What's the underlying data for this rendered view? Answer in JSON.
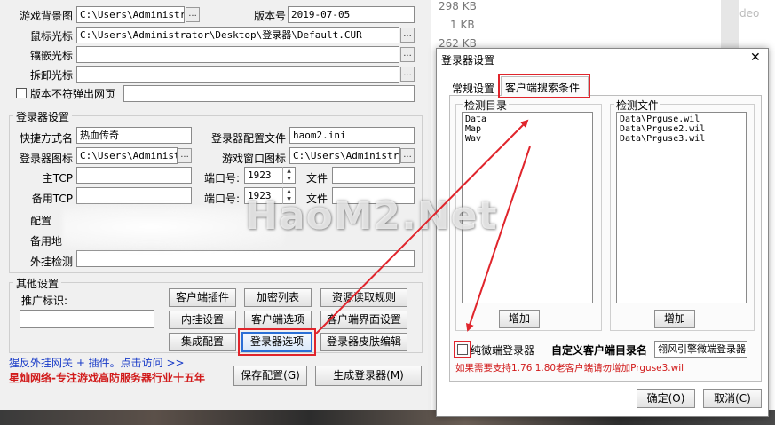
{
  "left": {
    "top_rows": {
      "game_bg_label": "游戏背景图",
      "game_bg_value": "C:\\Users\\Administrat",
      "version_label": "版本号",
      "version_value": "2019-07-05",
      "mouse_cursor_label": "鼠标光标",
      "mouse_cursor_value": "C:\\Users\\Administrator\\Desktop\\登录器\\Default.CUR",
      "inlay_cursor_label": "镶嵌光标",
      "unload_cursor_label": "拆卸光标",
      "version_popup_label": "版本不符弹出网页",
      "browse": "..."
    },
    "launcher_group": {
      "title": "登录器设置",
      "shortcut_label": "快捷方式名",
      "shortcut_value": "热血传奇",
      "config_file_label": "登录器配置文件",
      "config_file_value": "haom2.ini",
      "icon_label": "登录器图标",
      "icon_value": "C:\\Users\\Administra",
      "window_icon_label": "游戏窗口图标",
      "window_icon_value": "C:\\Users\\Administrato",
      "main_tcp_label": "主TCP",
      "port_label": "端口号:",
      "port1_value": "1923",
      "file_label": "文件",
      "backup_tcp_label": "备用TCP",
      "port2_value": "1923",
      "config_addr_label": "配置",
      "backup_addr_label": "备用地",
      "plugin_detect_label": "外挂检测"
    },
    "other_group": {
      "title": "其他设置",
      "promo_label": "推广标识:",
      "buttons": {
        "client_plugin": "客户端插件",
        "encrypt_list": "加密列表",
        "resource_rules": "资源读取规则",
        "inline_settings": "内挂设置",
        "client_options": "客户端选项",
        "client_ui_settings": "客户端界面设置",
        "integrated_config": "集成配置",
        "launcher_options": "登录器选项",
        "launcher_skin": "登录器皮肤编辑"
      }
    },
    "footer": {
      "anti_cheat_link": "猩反外挂网关 + 插件。点击访问 >>",
      "tagline": "星灿网络-专注游戏高防服务器行业十五年",
      "save_config": "保存配置(G)",
      "generate_launcher": "生成登录器(M)"
    }
  },
  "background_list": {
    "sizes": [
      "298 KB",
      "1 KB",
      "262 KB"
    ],
    "right_text": "deo"
  },
  "watermark": "HaoM2.Net",
  "dialog": {
    "title": "登录器设置",
    "close_glyph": "✕",
    "tabs": [
      "常规设置",
      "客户端搜索条件"
    ],
    "detect_dir_label": "检测目录",
    "detect_dirs": [
      "Data",
      "Map",
      "Wav"
    ],
    "detect_file_label": "检测文件",
    "detect_files": [
      "Data\\Prguse.wil",
      "Data\\Prguse2.wil",
      "Data\\Prguse3.wil"
    ],
    "add_button": "增加",
    "pure_micro_label": "纯微端登录器",
    "custom_dir_label": "自定义客户端目录名",
    "custom_dir_value": "翎风引擎微端登录器",
    "note": "如果需要支持1.76 1.80老客户端请勿增加Prguse3.wil",
    "ok": "确定(O)",
    "cancel": "取消(C)"
  },
  "colors": {
    "annotation_red": "#e0252c",
    "link_blue": "#1a3cc8",
    "tagline_red": "#d11a1a",
    "note_red": "#d11a1a",
    "focus_blue": "#2a6fd6"
  }
}
